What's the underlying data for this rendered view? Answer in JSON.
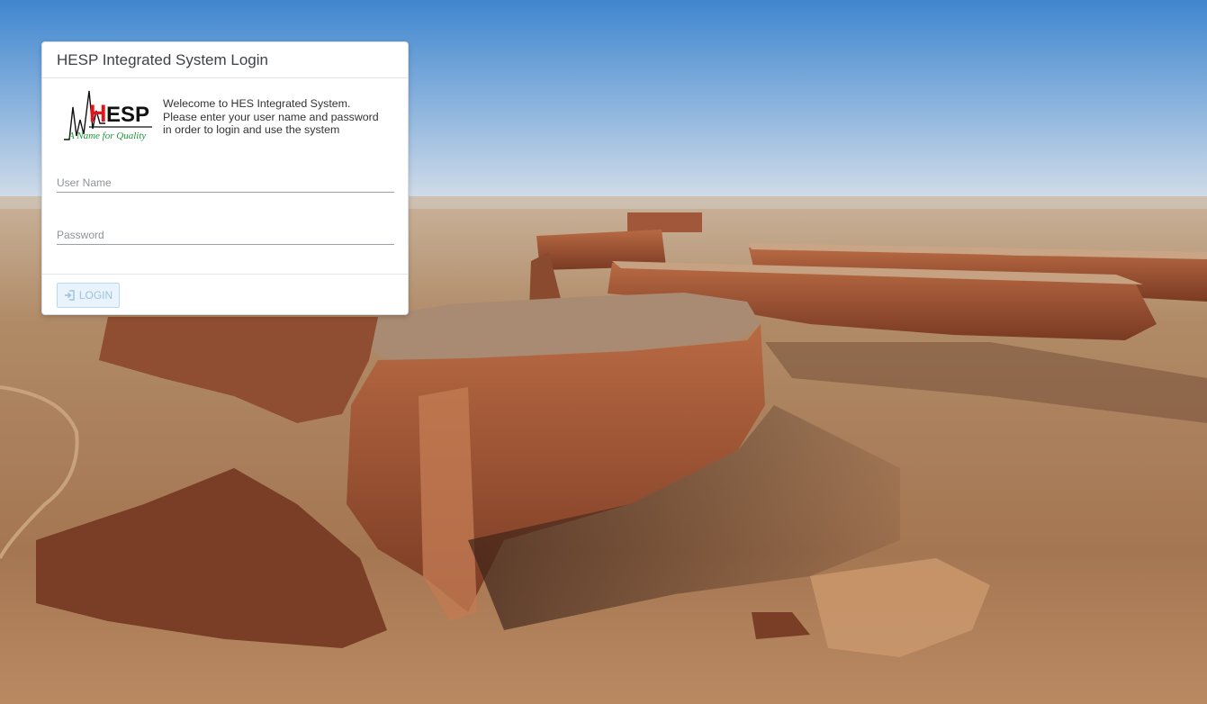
{
  "login_card": {
    "title": "HESP Integrated System Login",
    "logo": {
      "text": "HESP",
      "tagline": "A Name for Quality",
      "colors": {
        "H": "#e3151b",
        "ESP": "#111111",
        "tagline": "#1a9a3a"
      }
    },
    "welcome_lines": [
      "Welecome to HES Integrated System.",
      "Please enter your user name and password",
      "in order to login and use the system"
    ],
    "username": {
      "placeholder": "User Name",
      "value": ""
    },
    "password": {
      "placeholder": "Password",
      "value": ""
    },
    "login_button": {
      "label": "LOGIN",
      "icon": "sign-in-icon",
      "state": "disabled"
    }
  },
  "colors": {
    "sky_top": "#4a8fd3",
    "sky_horizon": "#c9d9ea",
    "desert_sand": "#a9825e",
    "rock_red": "#8d4a2e",
    "button_bg": "#e8f3fb",
    "button_text": "#9fc3de"
  }
}
